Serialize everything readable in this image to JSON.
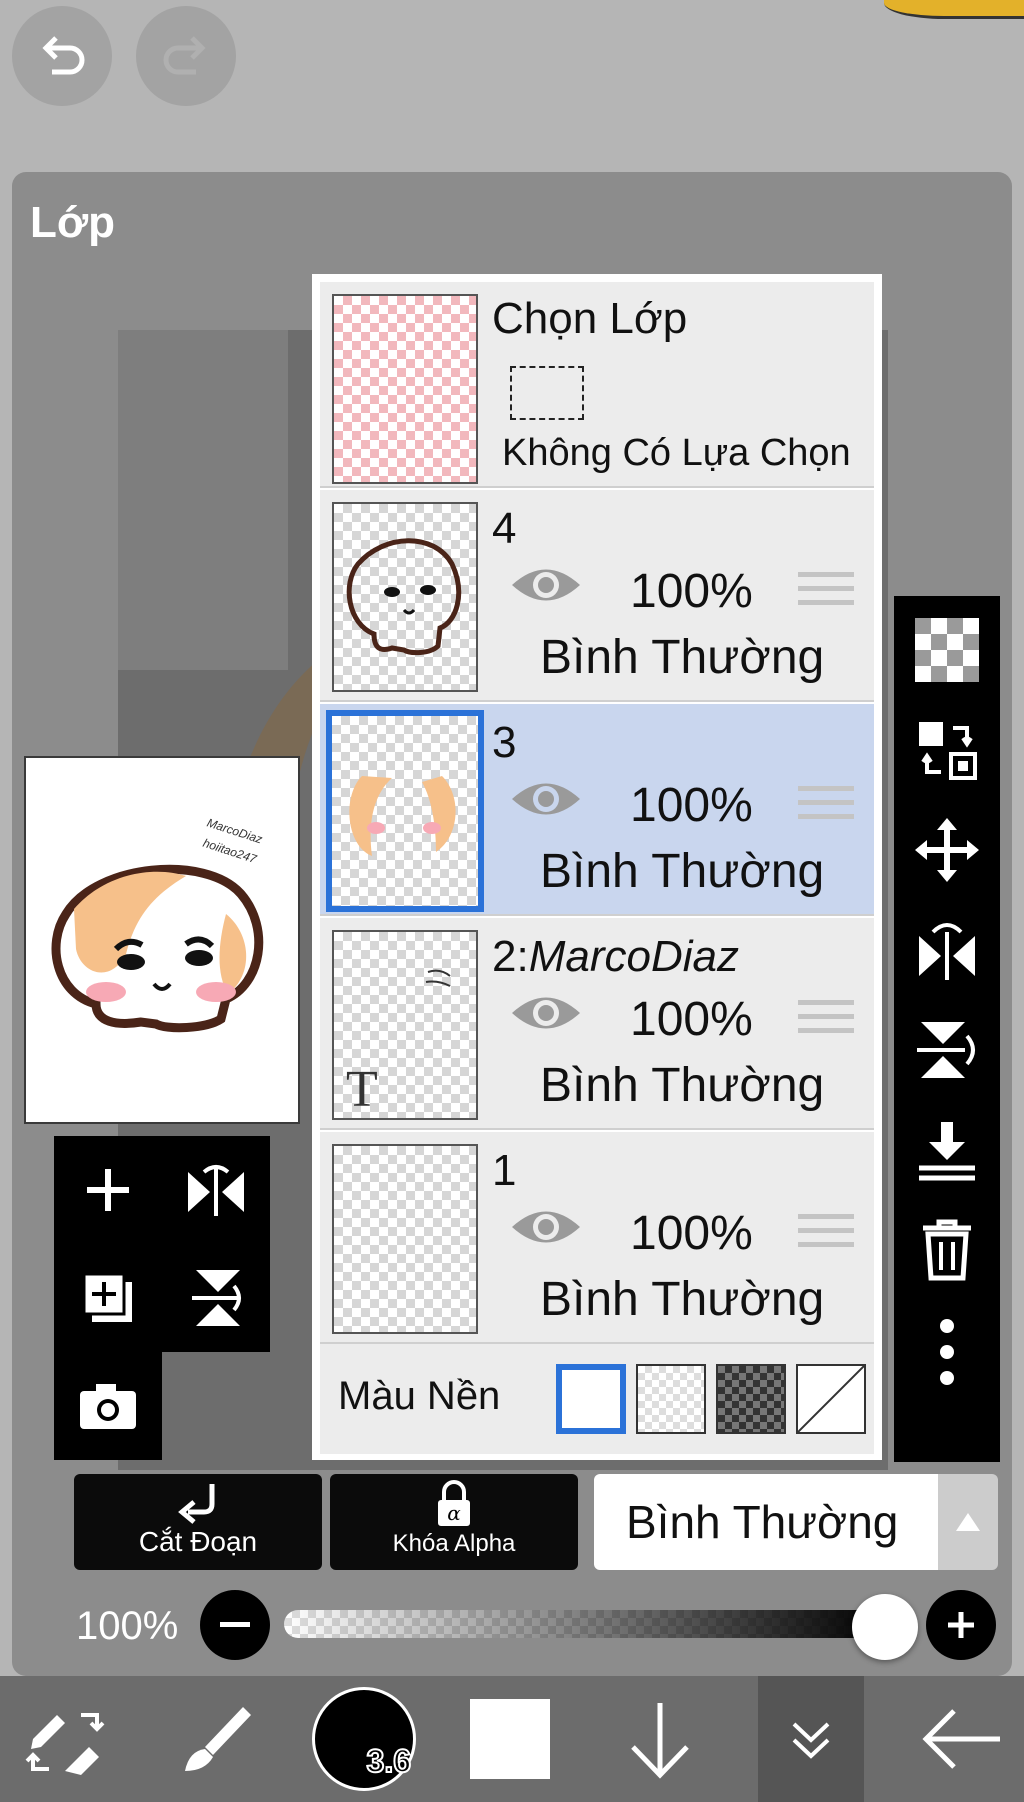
{
  "panel": {
    "title": "Lớp"
  },
  "layers": {
    "selection_row": {
      "title": "Chọn Lớp",
      "status": "Không Có Lựa Chọn"
    },
    "items": [
      {
        "name": "4",
        "opacity": "100%",
        "blend": "Bình Thường",
        "selected": false
      },
      {
        "name": "3",
        "opacity": "100%",
        "blend": "Bình Thường",
        "selected": true
      },
      {
        "name": "2:",
        "name_italic": "MarcoDiaz",
        "opacity": "100%",
        "blend": "Bình Thường",
        "selected": false,
        "thumb_glyph": "T"
      },
      {
        "name": "1",
        "opacity": "100%",
        "blend": "Bình Thường",
        "selected": false
      }
    ],
    "background_label": "Màu Nền"
  },
  "preview": {
    "signature_line1": "MarcoDiaz",
    "signature_line2": "hoiitao247"
  },
  "buttons": {
    "clipping": "Cắt Đoạn",
    "alpha_lock": "Khóa Alpha",
    "blend_mode": "Bình Thường"
  },
  "opacity": {
    "label": "100%",
    "value_percent": 100
  },
  "brush": {
    "size": "3.6"
  },
  "colors": {
    "selected_border": "#2b72d8",
    "selected_row": "#c9d6ee",
    "panel": "#8c8c8c"
  }
}
